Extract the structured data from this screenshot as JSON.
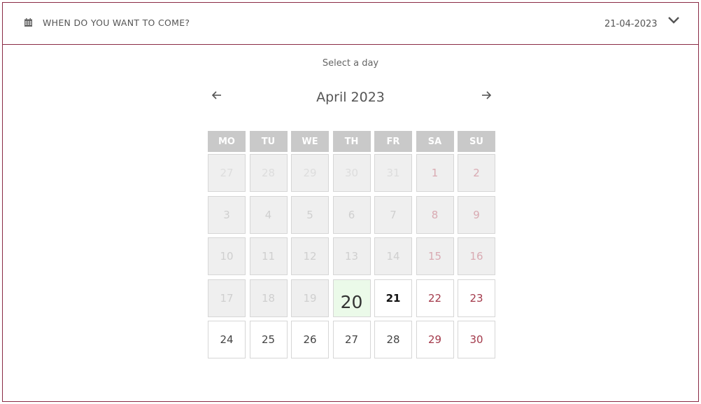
{
  "header": {
    "icon": "calendar-icon",
    "title": "WHEN DO YOU WANT TO COME?",
    "selected_date": "21-04-2023",
    "toggle_icon": "chevron-down-icon"
  },
  "calendar": {
    "hint": "Select a day",
    "month_label": "April 2023",
    "prev_icon": "arrow-left-icon",
    "next_icon": "arrow-right-icon",
    "weekdays": [
      "MO",
      "TU",
      "WE",
      "TH",
      "FR",
      "SA",
      "SU"
    ],
    "weeks": [
      [
        {
          "d": "27",
          "state": "disabled",
          "outside": true
        },
        {
          "d": "28",
          "state": "disabled",
          "outside": true
        },
        {
          "d": "29",
          "state": "disabled",
          "outside": true
        },
        {
          "d": "30",
          "state": "disabled",
          "outside": true
        },
        {
          "d": "31",
          "state": "disabled",
          "outside": true
        },
        {
          "d": "1",
          "state": "disabled",
          "weekend": true
        },
        {
          "d": "2",
          "state": "disabled",
          "weekend": true
        }
      ],
      [
        {
          "d": "3",
          "state": "disabled"
        },
        {
          "d": "4",
          "state": "disabled"
        },
        {
          "d": "5",
          "state": "disabled"
        },
        {
          "d": "6",
          "state": "disabled"
        },
        {
          "d": "7",
          "state": "disabled"
        },
        {
          "d": "8",
          "state": "disabled",
          "weekend": true
        },
        {
          "d": "9",
          "state": "disabled",
          "weekend": true
        }
      ],
      [
        {
          "d": "10",
          "state": "disabled"
        },
        {
          "d": "11",
          "state": "disabled"
        },
        {
          "d": "12",
          "state": "disabled"
        },
        {
          "d": "13",
          "state": "disabled"
        },
        {
          "d": "14",
          "state": "disabled"
        },
        {
          "d": "15",
          "state": "disabled",
          "weekend": true
        },
        {
          "d": "16",
          "state": "disabled",
          "weekend": true
        }
      ],
      [
        {
          "d": "17",
          "state": "disabled"
        },
        {
          "d": "18",
          "state": "disabled"
        },
        {
          "d": "19",
          "state": "disabled"
        },
        {
          "d": "20",
          "state": "today"
        },
        {
          "d": "21",
          "state": "selected"
        },
        {
          "d": "22",
          "state": "available",
          "weekend": true
        },
        {
          "d": "23",
          "state": "available",
          "weekend": true
        }
      ],
      [
        {
          "d": "24",
          "state": "available"
        },
        {
          "d": "25",
          "state": "available"
        },
        {
          "d": "26",
          "state": "available"
        },
        {
          "d": "27",
          "state": "available"
        },
        {
          "d": "28",
          "state": "available"
        },
        {
          "d": "29",
          "state": "available",
          "weekend": true
        },
        {
          "d": "30",
          "state": "available",
          "weekend": true
        }
      ]
    ]
  },
  "colors": {
    "border": "#8a2b45",
    "weekend_available": "#a33a4b",
    "weekend_disabled": "#d9aab2",
    "today_bg": "#ebfae9",
    "weekday_header_bg": "#c9c9c9",
    "disabled_bg": "#efefef"
  }
}
